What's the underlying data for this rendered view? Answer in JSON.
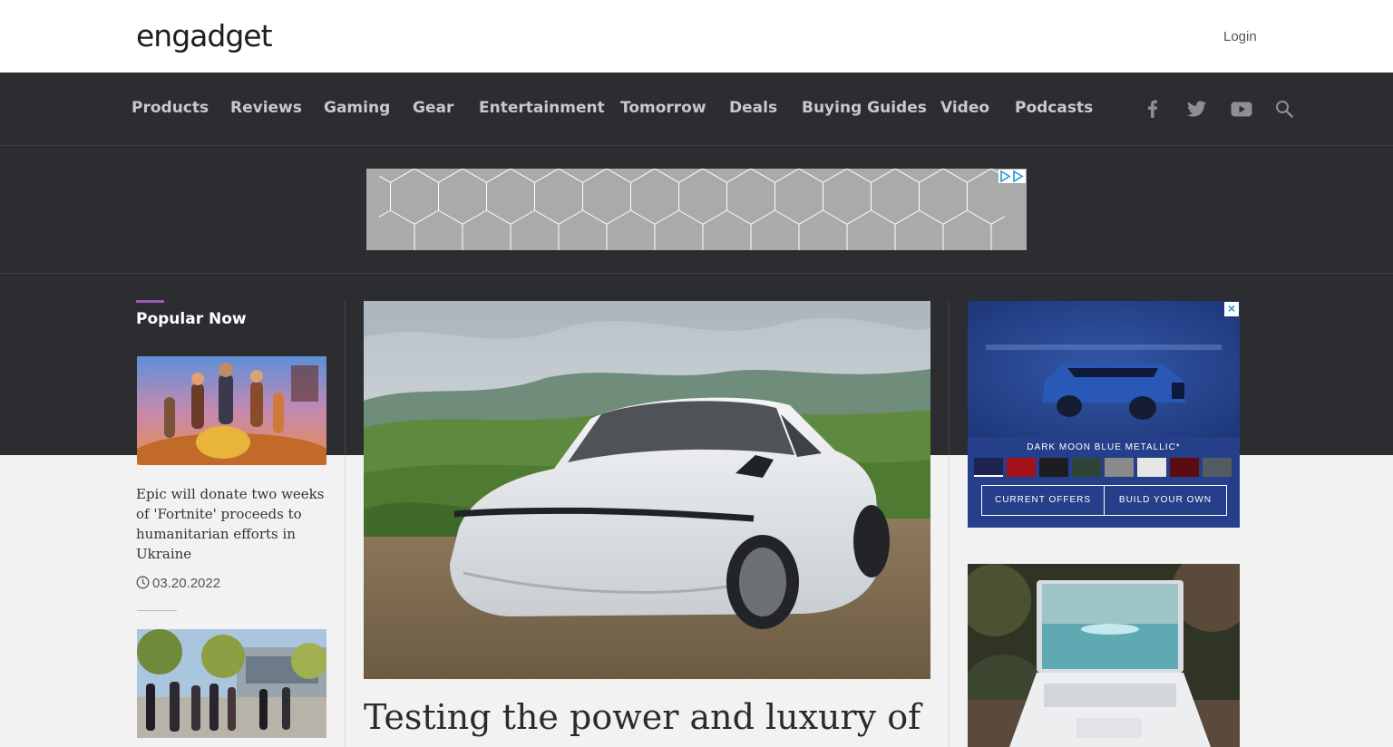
{
  "header": {
    "logo_text": "engadget",
    "login_label": "Login"
  },
  "nav": {
    "items": [
      {
        "label": "Products"
      },
      {
        "label": "Reviews"
      },
      {
        "label": "Gaming"
      },
      {
        "label": "Gear"
      },
      {
        "label": "Entertainment"
      },
      {
        "label": "Tomorrow"
      },
      {
        "label": "Deals"
      },
      {
        "label": "Buying Guides"
      },
      {
        "label": "Video"
      },
      {
        "label": "Podcasts"
      }
    ],
    "social_icons": [
      "facebook-icon",
      "twitter-icon",
      "youtube-icon",
      "search-icon"
    ]
  },
  "popular": {
    "title": "Popular Now",
    "articles": [
      {
        "headline": "Epic will donate two weeks of 'Fortnite' proceeds to humanitarian efforts in Ukraine",
        "date": "03.20.2022"
      }
    ]
  },
  "hero": {
    "title": "Testing the power and luxury of"
  },
  "side_ad": {
    "color_name": "DARK MOON BLUE METALLIC*",
    "current_offers_label": "CURRENT OFFERS",
    "build_label": "BUILD YOUR OWN",
    "swatch_colors": [
      "#1d2350",
      "#a3111a",
      "#1c1c22",
      "#2d4436",
      "#8a8a8a",
      "#e6e6e6",
      "#5c0b12",
      "#555b63"
    ],
    "background_color": "#253f8a"
  },
  "colors": {
    "nav_bg": "#2c2d31",
    "accent": "#9b59b6"
  }
}
